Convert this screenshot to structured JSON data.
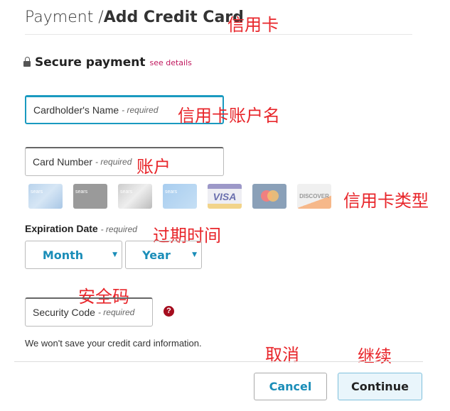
{
  "header": {
    "title_prefix": "Payment /",
    "title_main": "Add Credit Card"
  },
  "secure": {
    "label": "Secure payment",
    "link": "see details"
  },
  "fields": {
    "name": "Cardholder's Name",
    "number": "Card Number",
    "security": "Security Code",
    "required": "- required"
  },
  "cards": [
    "sears-card",
    "sears-mastercard-gray",
    "sears-mastercard-silver",
    "sears-commercial",
    "VISA",
    "mastercard",
    "DISCOVER"
  ],
  "card_texts": {
    "sears": "sears",
    "visa": "VISA",
    "discover": "DISCOVER"
  },
  "expiration": {
    "label": "Expiration Date",
    "required": "- required",
    "month": "Month",
    "year": "Year"
  },
  "notice": "We won't save your credit card information.",
  "buttons": {
    "cancel": "Cancel",
    "continue": "Continue"
  },
  "annotations": {
    "title": "信用卡",
    "name": "信用卡账户名",
    "number": "账户",
    "types": "信用卡类型",
    "expiry": "过期时间",
    "security": "安全码",
    "cancel": "取消",
    "continue": "继续"
  },
  "colors": {
    "accent": "#1a8db8",
    "link": "#c0185e",
    "help": "#a50d1e",
    "annotation": "#e8262b"
  }
}
